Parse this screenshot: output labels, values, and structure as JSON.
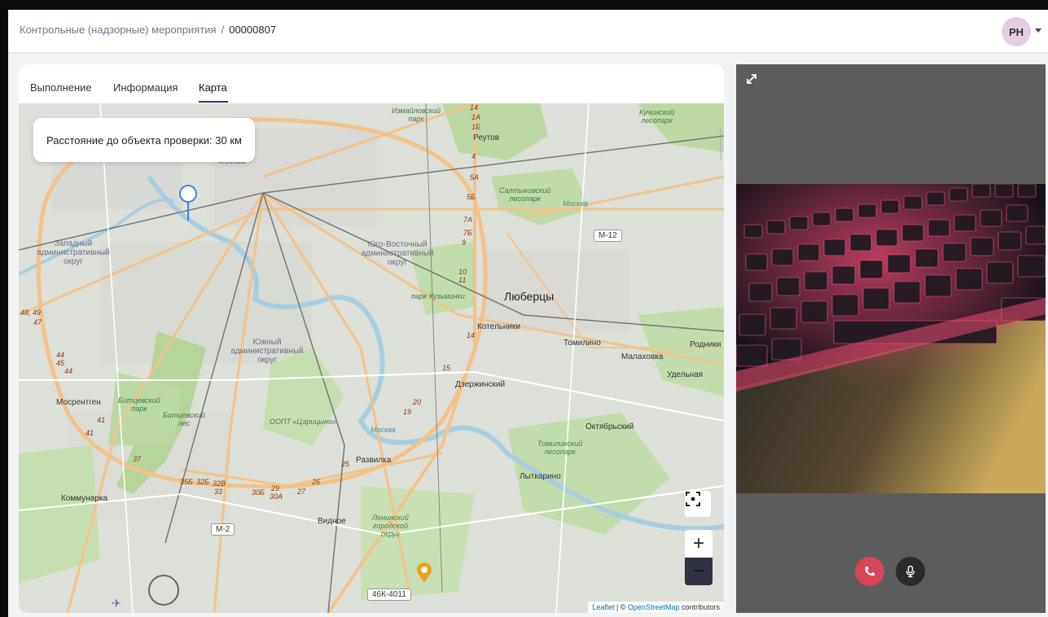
{
  "header": {
    "breadcrumb_parent": "Контрольные (надзорные) мероприятия",
    "breadcrumb_separator": "/",
    "breadcrumb_current": "00000807",
    "avatar_initials": "РН"
  },
  "tabs": [
    {
      "label": "Выполнение",
      "active": false
    },
    {
      "label": "Информация",
      "active": false
    },
    {
      "label": "Карта",
      "active": true
    }
  ],
  "map": {
    "distance_popup": "Расстояние до объекта проверки: 30 км",
    "attribution_leaflet": "Leaflet",
    "attribution_separator": " | © ",
    "attribution_osm": "OpenStreetMap",
    "attribution_suffix": " contributors",
    "zoom_in_label": "+",
    "zoom_out_label": "−",
    "labels": {
      "reutov": "Реутов",
      "lyubertsy": "Люберцы",
      "kotelniki": "Котельники",
      "tomilino": "Томилино",
      "malakhovka": "Малаховка",
      "udelnaya": "Удельная",
      "rodniki": "Родники",
      "dzerzhinsky": "Дзержинский",
      "oktyabrsky": "Октябрьский",
      "lytkarino": "Лыткарино",
      "razvilka": "Развилка",
      "vidnoe": "Видное",
      "kommunarka": "Коммунарка",
      "mosrentgen": "Мосрентген",
      "moskva": "Москва",
      "zao_1": "Западный",
      "zao_2": "административный",
      "zao_3": "округ",
      "uvao_1": "Юго-Восточный",
      "uvao_2": "административный",
      "uvao_3": "округ",
      "yuao_1": "Южный",
      "yuao_2": "административный",
      "yuao_3": "округ",
      "izmailovsky_1": "Измайловский",
      "izmailovsky_2": "парк",
      "kuchinsky_1": "Кучинский",
      "kuchinsky_2": "лесопарк",
      "saltykovsky_1": "Салтыковский",
      "saltykovsky_2": "лесопарк",
      "kuzminki": "парк Кузьминки",
      "bitsevsky_1": "Битцевский",
      "bitsevsky_2": "парк",
      "bitsevsky_les_1": "Битцевский",
      "bitsevsky_les_2": "лес",
      "tsaritsyno": "ООПТ «Царицыно»",
      "tomilinsky_1": "Томилинский",
      "tomilinsky_2": "лесопарк",
      "leninsky_1": "Ленинский",
      "leninsky_2": "городской",
      "leninsky_3": "округ",
      "river_moskva_1": "Москва",
      "river_moskva_2": "Москва",
      "m12": "М-12",
      "m2": "М-2",
      "road_46k": "46К-4011",
      "km_1a": "1А",
      "km_1b": "1Б",
      "km_2": "2",
      "km_4": "4",
      "km_5a": "5А",
      "km_5b": "5Б",
      "km_7a": "7А",
      "km_7b": "7Б",
      "km_8": "8",
      "km_9": "9",
      "km_10": "10",
      "km_11": "11",
      "km_14": "14",
      "km_15": "15",
      "km_19": "19",
      "km_20": "20",
      "km_25": "25",
      "km_26": "26",
      "km_27": "27",
      "km_29": "29",
      "km_30a": "30А",
      "km_30b": "30Б",
      "km_32b": "32Б",
      "km_32b2": "32В",
      "km_33": "33",
      "km_35b": "35Б",
      "km_37": "37",
      "km_41": "41",
      "km_41b": "41",
      "km_44": "44",
      "km_45": "45",
      "km_44b": "44",
      "km_47": "47",
      "km_48": "48, 49",
      "km_1c": "14"
    }
  },
  "video": {
    "call_button_color": "#d64558",
    "mic_button_color": "#2a2a2a"
  },
  "colors": {
    "accent": "#2a3a8a",
    "map_road_major": "#f3c38a",
    "map_river": "#a8cfe0",
    "map_park": "#bcd9a4",
    "marker": "#3b82f6"
  }
}
